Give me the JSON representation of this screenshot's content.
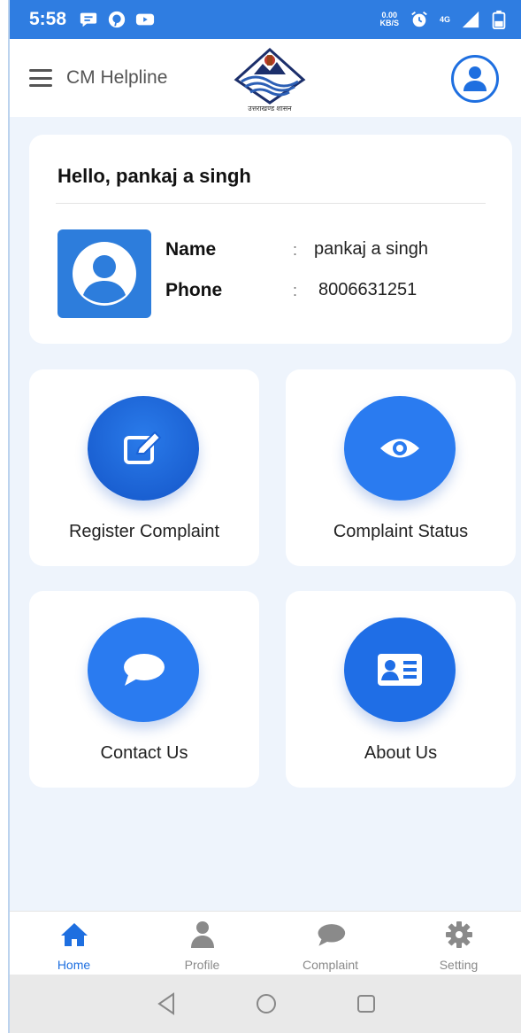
{
  "status_bar": {
    "time": "5:58",
    "speed_value": "0.00",
    "speed_unit": "KB/S",
    "network": "4G"
  },
  "app_bar": {
    "title": "CM Helpline",
    "logo_text": "उत्तराखण्ड शासन"
  },
  "user_card": {
    "greeting": "Hello, pankaj a singh",
    "name_label": "Name",
    "name_value": "pankaj a singh",
    "phone_label": "Phone",
    "phone_value": "8006631251",
    "colon": ":"
  },
  "tiles": [
    {
      "label": "Register Complaint",
      "icon": "edit-icon"
    },
    {
      "label": "Complaint Status",
      "icon": "eye-icon"
    },
    {
      "label": "Contact Us",
      "icon": "chat-bubble-icon"
    },
    {
      "label": "About Us",
      "icon": "id-card-icon"
    }
  ],
  "bottom_nav": [
    {
      "label": "Home",
      "icon": "home-icon",
      "active": true
    },
    {
      "label": "Profile",
      "icon": "person-icon",
      "active": false
    },
    {
      "label": "Complaint",
      "icon": "chat-bubble-icon",
      "active": false
    },
    {
      "label": "Setting",
      "icon": "gear-icon",
      "active": false
    }
  ],
  "colors": {
    "primary": "#1e6fe0",
    "status_bar": "#2f7de1",
    "background": "#eef4fc",
    "inactive": "#8a8a8a"
  }
}
